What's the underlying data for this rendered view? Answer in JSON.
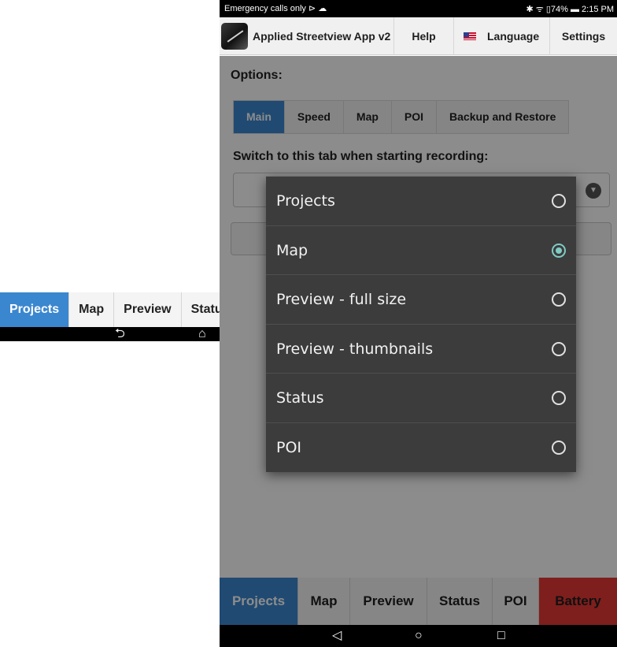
{
  "fragment": {
    "tabs": [
      {
        "label": "Projects",
        "active": true
      },
      {
        "label": "Map"
      },
      {
        "label": "Preview"
      },
      {
        "label": "Statu"
      }
    ],
    "nav": {
      "back": "⮌",
      "home": "⌂"
    }
  },
  "statusbar": {
    "left": "Emergency calls only ⊳ ☁",
    "right": "✱ ᯤ ▯74% ▬ 2:15 PM"
  },
  "appbar": {
    "title": "Applied Streetview App v2",
    "help": "Help",
    "language": "Language",
    "settings": "Settings"
  },
  "options": {
    "label": "Options:",
    "tabs": [
      {
        "label": "Main",
        "active": true
      },
      {
        "label": "Speed"
      },
      {
        "label": "Map"
      },
      {
        "label": "POI"
      },
      {
        "label": "Backup and Restore"
      }
    ],
    "switch_label": "Switch to this tab when starting recording:",
    "select_chevron": "▼"
  },
  "dialog": {
    "options": [
      {
        "label": "Projects",
        "selected": false
      },
      {
        "label": "Map",
        "selected": true
      },
      {
        "label": "Preview - full size",
        "selected": false
      },
      {
        "label": "Preview - thumbnails",
        "selected": false
      },
      {
        "label": "Status",
        "selected": false
      },
      {
        "label": "POI",
        "selected": false
      }
    ]
  },
  "bottom_tabs": [
    {
      "label": "Projects",
      "active": true
    },
    {
      "label": "Map"
    },
    {
      "label": "Preview"
    },
    {
      "label": "Status"
    },
    {
      "label": "POI"
    },
    {
      "label": "Battery",
      "alert": true
    }
  ],
  "navbar": {
    "back": "◁",
    "home": "○",
    "recents": "□"
  },
  "colors": {
    "accent": "#3b87cf",
    "battery_alert": "#e53935",
    "radio_selected": "#80cbc4",
    "dialog_bg": "#3c3c3c"
  }
}
